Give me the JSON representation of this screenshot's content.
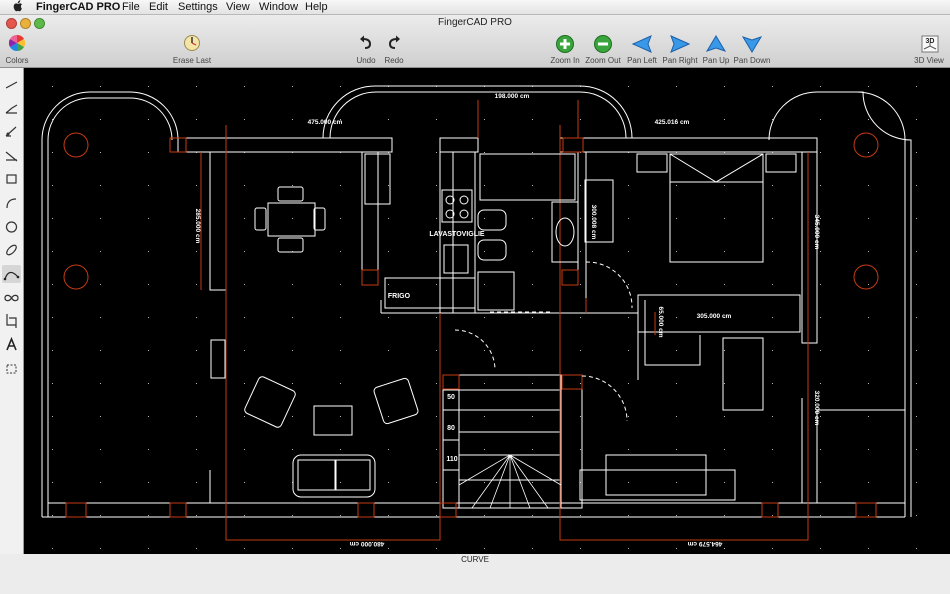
{
  "menubar": {
    "app_name": "FingerCAD PRO",
    "items": [
      "File",
      "Edit",
      "Settings",
      "View",
      "Window",
      "Help"
    ]
  },
  "window": {
    "title": "FingerCAD PRO"
  },
  "toolbar": {
    "colors": "Colors",
    "erase_last": "Erase Last",
    "undo": "Undo",
    "redo": "Redo",
    "zoom_in": "Zoom In",
    "zoom_out": "Zoom Out",
    "pan_left": "Pan Left",
    "pan_right": "Pan Right",
    "pan_up": "Pan Up",
    "pan_down": "Pan Down",
    "view_3d": "3D View",
    "view_3d_icon_text": "3D"
  },
  "palette_tools": [
    "line-tool",
    "polyline-tool",
    "angle-line-tool",
    "dimension-tool",
    "rectangle-tool",
    "arc-tool",
    "circle-tool",
    "ellipse-tool",
    "curve-tool",
    "infinity-tool",
    "crop-tool",
    "text-tool",
    "selection-tool"
  ],
  "drawing": {
    "dimensions": {
      "d1": "198.000 cm",
      "d2": "475.000 cm",
      "d3": "425.016 cm",
      "d4": "285.000 cm",
      "d5": "300.008 cm",
      "d6": "345.000 cm",
      "d7": "305.000 cm",
      "d8": "65.000 cm",
      "d9": "320.000 cm",
      "d10": "480.000 cm",
      "d11": "464.579 cm"
    },
    "labels": {
      "dishwasher": "LAVASTOVIGLIE",
      "fridge": "FRIGO",
      "step1": "50",
      "step2": "80",
      "step3": "110"
    }
  },
  "status": {
    "mode": "CURVE"
  },
  "colors": {
    "canvas_bg": "#000000",
    "wall_line": "#ffffff",
    "dimension_line": "#c43b12",
    "zoom_green": "#36a83a",
    "pan_blue": "#2f8fe0"
  }
}
